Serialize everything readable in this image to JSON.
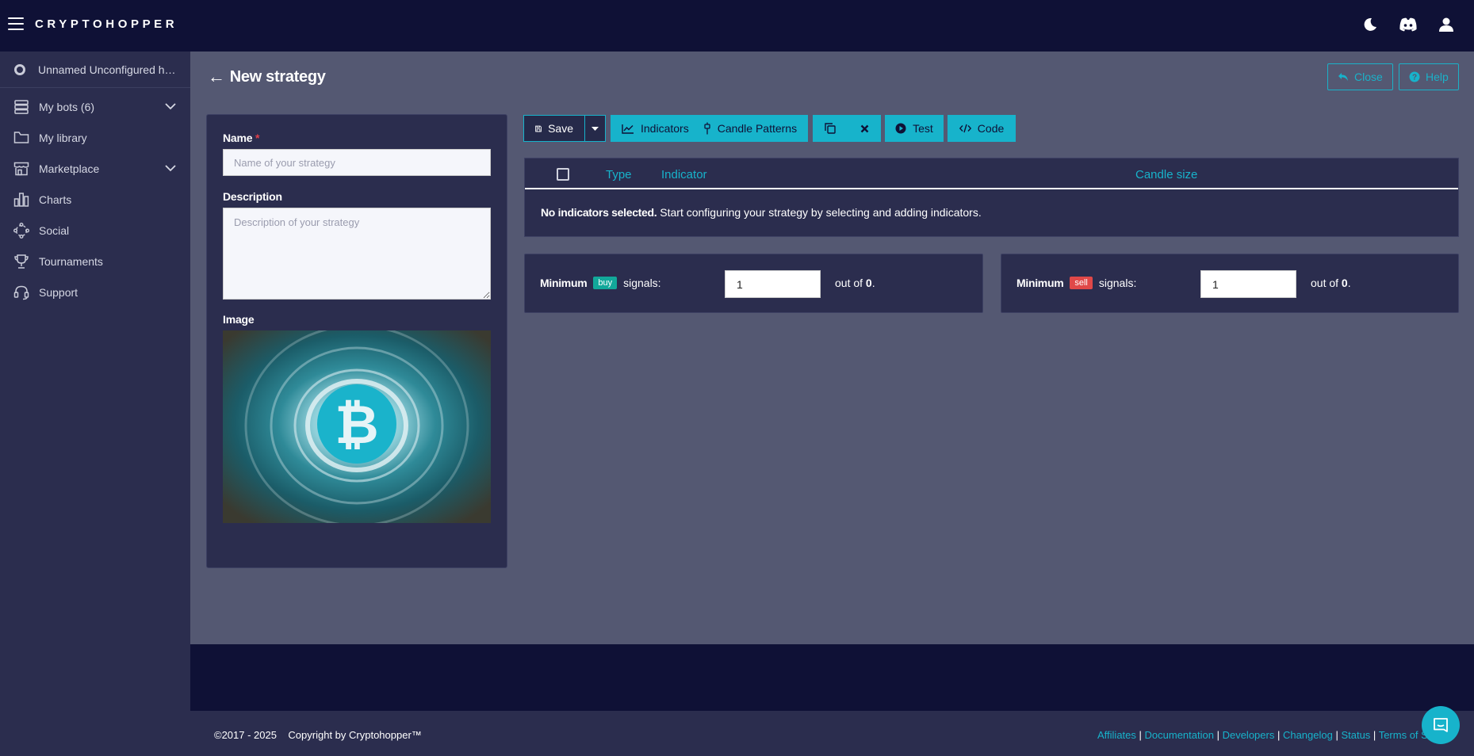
{
  "brand": {
    "logo_text": "CRYPTOHOPPER",
    "accent": "#17b3cb",
    "nav_bg": "#0f1136",
    "panel_bg": "#2b2d4e",
    "main_bg": "#545872"
  },
  "topbar": {
    "icons": [
      "moon-icon",
      "discord-icon",
      "user-icon"
    ]
  },
  "sidebar": {
    "hopper": "Unnamed Unconfigured ho...",
    "items": [
      {
        "label": "My bots (6)",
        "icon": "server-icon",
        "expandable": true
      },
      {
        "label": "My library",
        "icon": "folder-icon",
        "expandable": false
      },
      {
        "label": "Marketplace",
        "icon": "store-icon",
        "expandable": true
      },
      {
        "label": "Charts",
        "icon": "chart-bars-icon",
        "expandable": false
      },
      {
        "label": "Social",
        "icon": "social-icon",
        "expandable": false
      },
      {
        "label": "Tournaments",
        "icon": "trophy-icon",
        "expandable": false
      },
      {
        "label": "Support",
        "icon": "headset-icon",
        "expandable": false
      }
    ]
  },
  "page": {
    "back_arrow": "←",
    "title": "New strategy",
    "close_label": "Close",
    "help_label": "Help"
  },
  "form": {
    "name_label": "Name",
    "required_mark": "*",
    "name_placeholder": "Name of your strategy",
    "description_label": "Description",
    "description_placeholder": "Description of your strategy",
    "image_label": "Image"
  },
  "toolbar": {
    "save_label": "Save",
    "indicators_label": "Indicators",
    "candle_patterns_label": "Candle Patterns",
    "test_label": "Test",
    "code_label": "Code"
  },
  "indicators_table": {
    "columns": [
      "Type",
      "Indicator",
      "Candle size"
    ],
    "empty_bold": "No indicators selected.",
    "empty_text": " Start configuring your strategy by selecting and adding indicators."
  },
  "signals": {
    "buy": {
      "prefix": "Minimum",
      "badge": "buy",
      "badge_color": "#12a89a",
      "suffix": "signals:",
      "value": "1",
      "out_of_text": "out of",
      "out_of_value": "0",
      "period": "."
    },
    "sell": {
      "prefix": "Minimum",
      "badge": "sell",
      "badge_color": "#e04848",
      "suffix": "signals:",
      "value": "1",
      "out_of_text": "out of",
      "out_of_value": "0",
      "period": "."
    }
  },
  "footer": {
    "copyright": "©2017 - 2025    Copyright by Cryptohopper™",
    "links": [
      "Affiliates",
      "Documentation",
      "Developers",
      "Changelog",
      "Status",
      "Terms of Se"
    ]
  }
}
